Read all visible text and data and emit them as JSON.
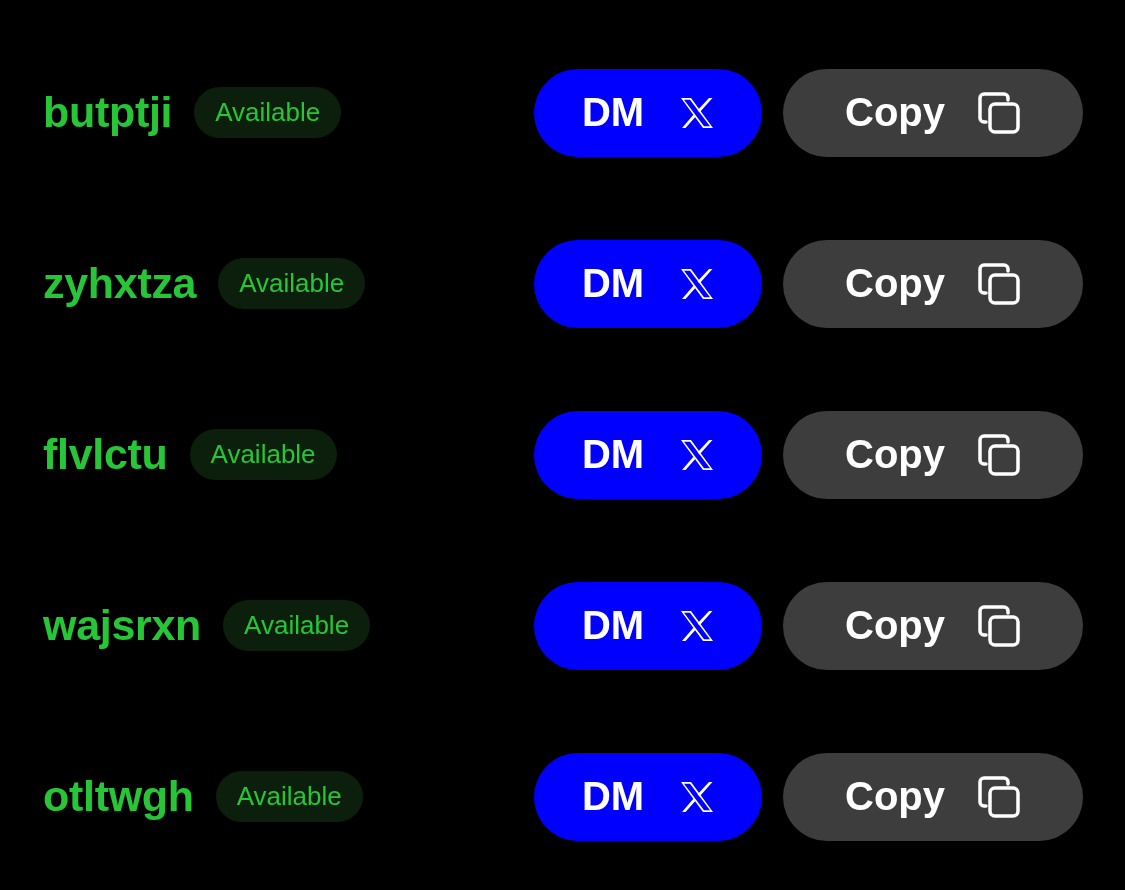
{
  "rows": [
    {
      "name": "butptji",
      "status": "Available",
      "dm_label": "DM",
      "copy_label": "Copy"
    },
    {
      "name": "zyhxtza",
      "status": "Available",
      "dm_label": "DM",
      "copy_label": "Copy"
    },
    {
      "name": "flvlctu",
      "status": "Available",
      "dm_label": "DM",
      "copy_label": "Copy"
    },
    {
      "name": "wajsrxn",
      "status": "Available",
      "dm_label": "DM",
      "copy_label": "Copy"
    },
    {
      "name": "otltwgh",
      "status": "Available",
      "dm_label": "DM",
      "copy_label": "Copy"
    }
  ]
}
